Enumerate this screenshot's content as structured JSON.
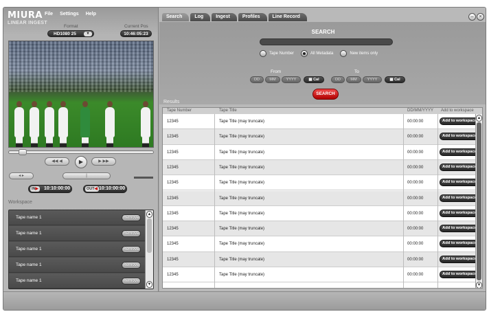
{
  "app": {
    "logo": "MIURA",
    "subtitle": "LINEAR INGEST"
  },
  "menu": [
    "File",
    "Settings",
    "Help"
  ],
  "format": {
    "label": "Format",
    "value": "HD1080 25"
  },
  "current_pos": {
    "label": "Current Pos",
    "value": "10:46:05:23"
  },
  "transport": {
    "play_icon": "play-icon"
  },
  "timecode": {
    "in_tag": "IN",
    "in_value": "10:10:00:00",
    "out_tag": "OUT",
    "out_value": "10:10:00:00"
  },
  "workspace": {
    "title": "Workspace",
    "remove_label": "Remove",
    "items": [
      "Tape name 1",
      "Tape name 1",
      "Tape name 1",
      "Tape name 1",
      "Tape name 1"
    ]
  },
  "tabs": [
    "Search",
    "Log",
    "Ingest",
    "Profiles",
    "Line Record"
  ],
  "search": {
    "title": "SEARCH",
    "query": "",
    "radios": [
      "Tape Number",
      "All Metadata",
      "New items only"
    ],
    "selected_radio": "All Metadata",
    "from_label": "From",
    "to_label": "To",
    "date_parts": [
      "DD",
      "MM",
      "YYYY"
    ],
    "cal_label": "Cal",
    "button": "SEARCH"
  },
  "results": {
    "label": "Results",
    "columns": [
      "Tape Number",
      "Tape Title",
      "DD/MM/YYYY",
      "Add to workspace"
    ],
    "add_label": "Add to workspace",
    "rows": [
      [
        "12345",
        "Tape Title (may truncate)",
        "00:00:00"
      ],
      [
        "12345",
        "Tape Title (may truncate)",
        "00:00:00"
      ],
      [
        "12345",
        "Tape Title (may truncate)",
        "00:00:00"
      ],
      [
        "12345",
        "Tape Title (may truncate)",
        "00:00:00"
      ],
      [
        "12345",
        "Tape Title (may truncate)",
        "00:00:00"
      ],
      [
        "12345",
        "Tape Title (may truncate)",
        "00:00:00"
      ],
      [
        "12345",
        "Tape Title (may truncate)",
        "00:00:00"
      ],
      [
        "12345",
        "Tape Title (may truncate)",
        "00:00:00"
      ],
      [
        "12345",
        "Tape Title (may truncate)",
        "00:00:00"
      ],
      [
        "12345",
        "Tape Title (may truncate)",
        "00:00:00"
      ],
      [
        "12345",
        "Tape Title (may truncate)",
        "00:00:00"
      ]
    ]
  },
  "colors": {
    "search_button": "#d41414",
    "dark_pill": "#2a2a2a",
    "panel": "#b4b4b4"
  }
}
